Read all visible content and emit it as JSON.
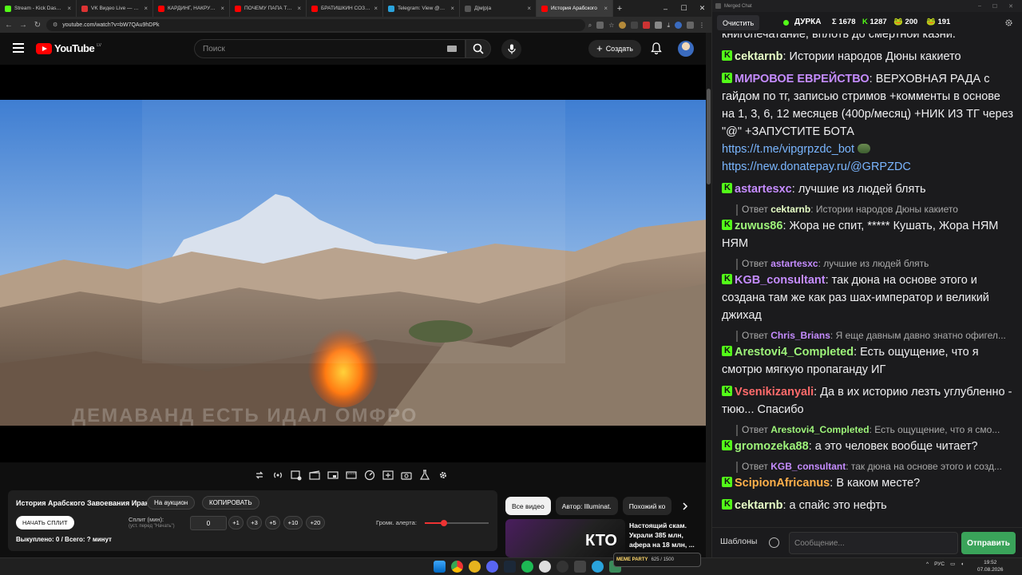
{
  "browser": {
    "tabs": [
      {
        "label": "Stream - Kick Dashbo",
        "color": "#53fc18"
      },
      {
        "label": "VK Видео Live — стри",
        "color": "#d33"
      },
      {
        "label": "КАРДИНГ, НАКРУТКА",
        "color": "#f00"
      },
      {
        "label": "ПОЧЕМУ ПАПА ТЕБЯ",
        "color": "#f00"
      },
      {
        "label": "БРАТИШКИН СОЗДА",
        "color": "#f00"
      },
      {
        "label": "Telegram: View @goc",
        "color": "#2aa3dc"
      },
      {
        "label": "Д|м|р|а",
        "color": "#555"
      },
      {
        "label": "История Арабского",
        "color": "#f00",
        "active": true
      }
    ],
    "new_tab": "+",
    "window_controls": [
      "–",
      "☐",
      "✕"
    ],
    "url": "youtube.com/watch?v=bW7QAu9hDPk"
  },
  "youtube": {
    "logo_text": "YouTube",
    "logo_sup": "LV",
    "search_placeholder": "Поиск",
    "create_label": "Создать"
  },
  "video": {
    "overlay_text": "ДЕМАВАНД ЕСТЬ ИДАЛ ОМФРО",
    "title": "История Арабского Завоевания Ирана"
  },
  "panel": {
    "auction_label": "На аукцион",
    "copy_label": "КОПИРОВАТЬ",
    "start_split_label": "НАЧАТЬ СПЛИТ",
    "split_label": "Сплит (мин):",
    "split_hint": "(уст. перед \"Начать\")",
    "split_value": "0",
    "increments": [
      "+1",
      "+3",
      "+5",
      "+10",
      "+20"
    ],
    "alert_volume_label": "Громк. алерта:",
    "alert_volume": 0.3,
    "bought_text": "Выкуплено: 0 / Всего: ? минут"
  },
  "recs": {
    "chips": [
      "Все видео",
      "Автор: Illuminat.",
      "Похожий ко"
    ],
    "thumb_text": "КТО",
    "title": "Настоящий скам. Украли 385 млн, афера на 18 млн, ..."
  },
  "chat": {
    "window_title": "Merged Chat",
    "clear_label": "Очистить",
    "channel": "ДУРКА",
    "stats": [
      {
        "icon": "Σ",
        "value": "1678",
        "color": "#ffffff"
      },
      {
        "icon": "K",
        "value": "1287",
        "color": "#53fc18"
      },
      {
        "icon": "🐸",
        "value": "200",
        "color": "#ffffff"
      },
      {
        "icon": "🐸",
        "value": "191",
        "color": "#ffffff"
      }
    ],
    "top_fragment": "книгопечатание, вплоть до смертной казни.",
    "messages": [
      {
        "user": "cektarnb",
        "color": "#e7ffc6",
        "text": "Истории народов Дюны какието"
      },
      {
        "user": "МИРОВОЕ ЕВРЕЙСТВО",
        "color": "#c58cff",
        "text": "ВЕРХОВНАЯ РАДА с гайдом по тг, записью стримов +комменты в основе  на 1, 3, 6, 12 месяцев (400р/месяц) +НИК ИЗ ТГ через \"@\" +ЗАПУСТИТЕ БОТА",
        "links": [
          "https://t.me/vipgrpzdc_bot",
          "https://new.donatepay.ru/@GRPZDC"
        ]
      },
      {
        "user": "astartesxc",
        "color": "#c58cff",
        "text": "лучшие из людей блять"
      },
      {
        "user": "zuwus86",
        "color": "#9ef47a",
        "text": "Жора не спит, ***** Кушать, Жора НЯМ НЯМ",
        "reply_user": "cektarnb",
        "reply_text": "Истории народов Дюны какието",
        "reply_color": "#e7ffc6"
      },
      {
        "user": "KGB_consultant",
        "color": "#c58cff",
        "text": "так дюна на основе этого и создана там же как раз шах-император и великий джихад",
        "reply_user": "astartesxc",
        "reply_text": "лучшие из людей блять",
        "reply_color": "#c58cff"
      },
      {
        "user": "Arestovi4_Completed",
        "color": "#9ef47a",
        "text": "Есть ощущение, что я смотрю мягкую пропаганду ИГ",
        "reply_user": "Chris_Brians",
        "reply_text": "Я еще давным давно знатно офигел...",
        "reply_color": "#c58cff"
      },
      {
        "user": "Vsenikizanyali",
        "color": "#ff6b6b",
        "text": "Да в их историю лезть углубленно - тюю... Спасибо"
      },
      {
        "user": "gromozeka88",
        "color": "#9ef47a",
        "text": "а это человек вообще читает?",
        "reply_user": "Arestovi4_Completed",
        "reply_text": "Есть ощущение, что я смо...",
        "reply_color": "#9ef47a"
      },
      {
        "user": "ScipionAfricanus",
        "color": "#ffb04a",
        "text": "В каком месте?",
        "reply_user": "KGB_consultant",
        "reply_text": "так дюна на основе этого и созд...",
        "reply_color": "#c58cff"
      },
      {
        "user": "cektarnb",
        "color": "#e7ffc6",
        "text": "а спайс это нефть"
      }
    ],
    "reply_prefix": "Ответ",
    "templates_label": "Шаблоны",
    "input_placeholder": "Сообщение...",
    "send_label": "Отправить"
  },
  "taskbar": {
    "overlay_label": "MEME PARTY",
    "overlay_progress": "625 / 1500",
    "lang": "РУС",
    "time": "19:52",
    "date": "07.08.2026"
  }
}
